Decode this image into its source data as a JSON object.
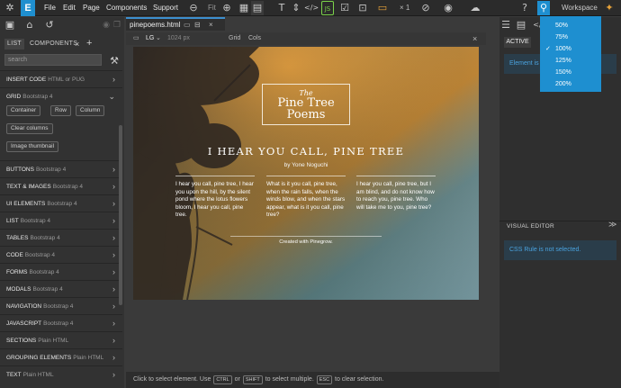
{
  "menu": [
    "File",
    "Edit",
    "Page",
    "Components",
    "Support"
  ],
  "toolbar": {
    "fit_label": "Fit",
    "count_label": "× 1",
    "workspace_label": "Workspace"
  },
  "left_panel": {
    "tab_list": "LIST",
    "tab_components": "COMPONENTS",
    "search_placeholder": "search",
    "sections": [
      {
        "title": "INSERT CODE",
        "sub": "HTML or PUG"
      },
      {
        "title": "GRID",
        "sub": "Bootstrap 4"
      },
      {
        "title": "BUTTONS",
        "sub": "Bootstrap 4"
      },
      {
        "title": "TEXT & IMAGES",
        "sub": "Bootstrap 4"
      },
      {
        "title": "UI ELEMENTS",
        "sub": "Bootstrap 4"
      },
      {
        "title": "LIST",
        "sub": "Bootstrap 4"
      },
      {
        "title": "TABLES",
        "sub": "Bootstrap 4"
      },
      {
        "title": "CODE",
        "sub": "Bootstrap 4"
      },
      {
        "title": "FORMS",
        "sub": "Bootstrap 4"
      },
      {
        "title": "MODALS",
        "sub": "Bootstrap 4"
      },
      {
        "title": "NAVIGATION",
        "sub": "Bootstrap 4"
      },
      {
        "title": "JAVASCRIPT",
        "sub": "Bootstrap 4"
      },
      {
        "title": "SECTIONS",
        "sub": "Plain HTML"
      },
      {
        "title": "GROUPING ELEMENTS",
        "sub": "Plain HTML"
      },
      {
        "title": "TEXT",
        "sub": "Plain HTML"
      }
    ],
    "grid_buttons": [
      "Container",
      "Row",
      "Column",
      "Clear columns",
      "Image thumbnail"
    ]
  },
  "document": {
    "tab_name": "pinepoems.html",
    "device": "LG",
    "width": "1024 px",
    "grid": "Grid",
    "cols": "Cols"
  },
  "page": {
    "logo_the": "The",
    "logo_line1": "Pine Tree",
    "logo_line2": "Poems",
    "heading": "I HEAR YOU CALL, PINE TREE",
    "byline": "by Yone Noguchi",
    "col1": "I hear you call, pine tree, I hear you upon the hill, by the silent pond where the lotus flowers bloom, I hear you call, pine tree.",
    "col2": "What is it you call, pine tree, when the rain falls, when the winds blow, and when the stars appear, what is it you call, pine tree?",
    "col3": "I hear you call, pine tree, but I am blind, and do not know how to reach you, pine tree. Who will take me to you, pine tree?",
    "footer": "Created with Pinegrow."
  },
  "right_panel": {
    "active_tab": "ACTIVE",
    "element_text": "Element is",
    "visual_editor": "VISUAL EDITOR",
    "css_rule": "CSS Rule is not selected."
  },
  "zoom": {
    "options": [
      "50%",
      "75%",
      "100%",
      "125%",
      "150%",
      "200%"
    ],
    "selected_index": 2
  },
  "status": {
    "p1": "Click to select element. Use",
    "k1": "CTRL",
    "p2": "or",
    "k2": "SHIFT",
    "p3": "to select multiple.",
    "k3": "ESC",
    "p4": "to clear selection."
  },
  "colors": {
    "accent": "#1e8fd0",
    "link": "#4aa3df"
  }
}
